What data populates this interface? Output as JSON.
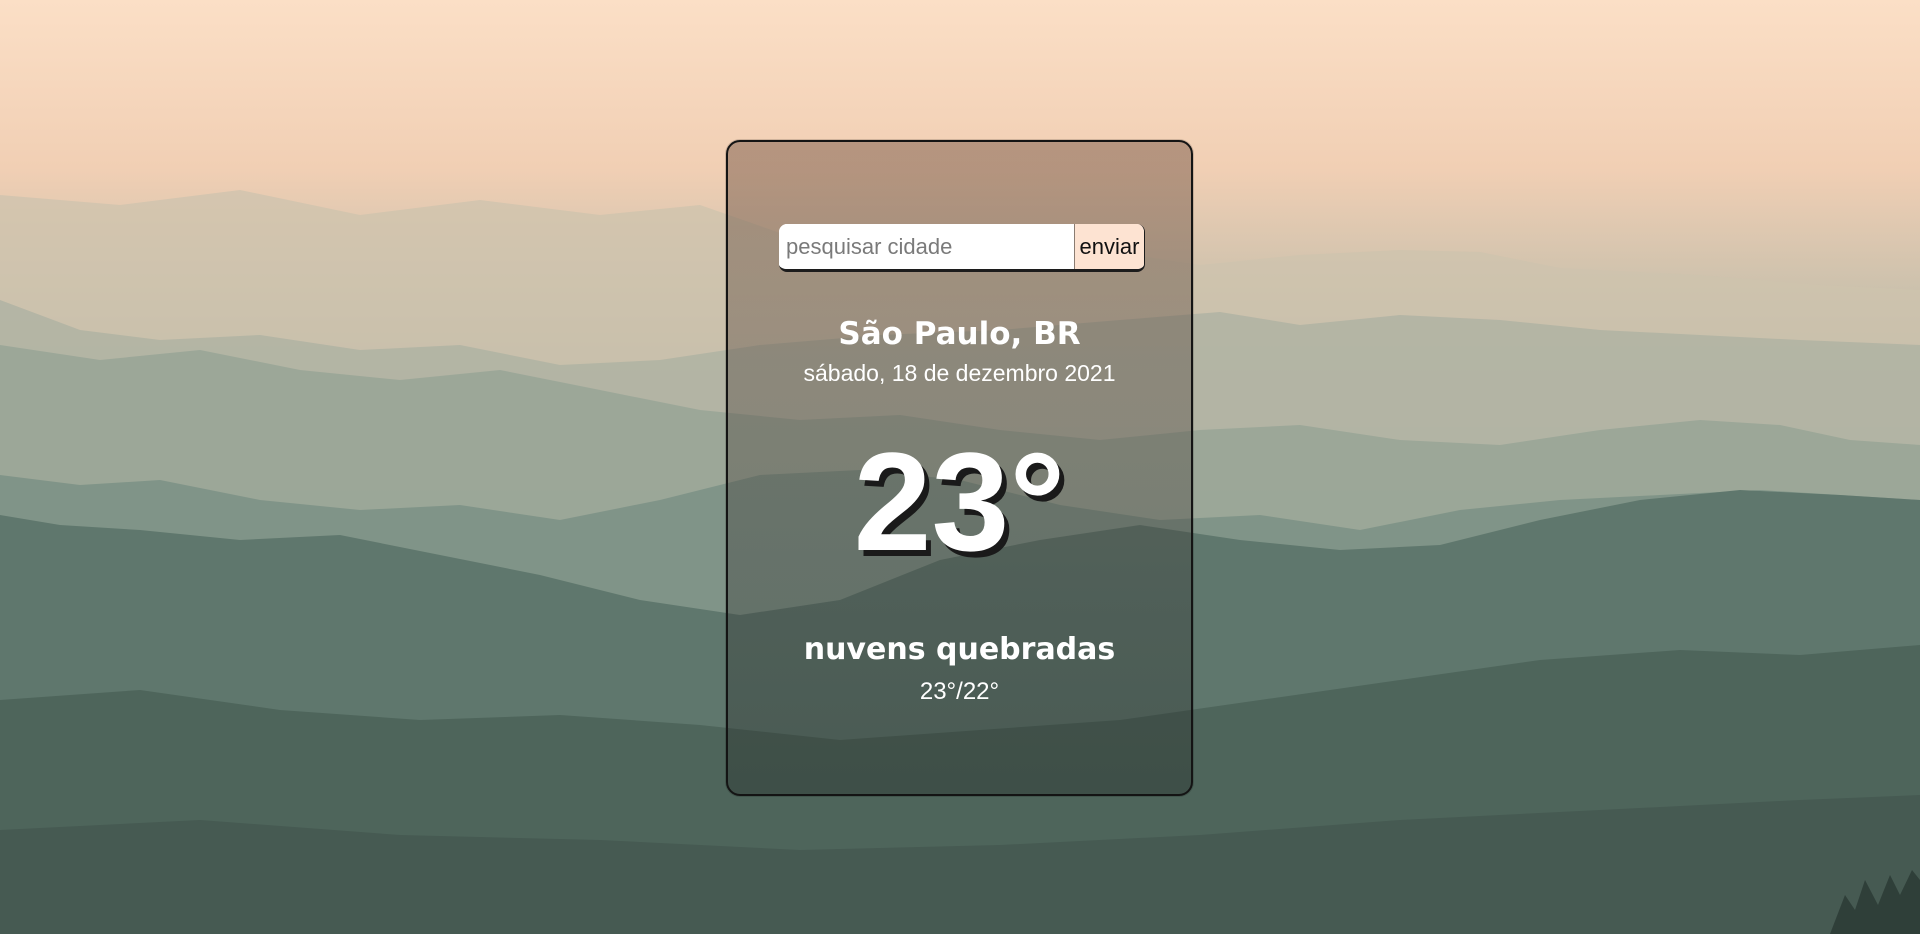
{
  "search": {
    "placeholder": "pesquisar cidade",
    "value": "",
    "button_label": "enviar"
  },
  "weather": {
    "city": "São Paulo, BR",
    "date": "sábado, 18 de dezembro 2021",
    "temperature": "23°",
    "condition": "nuvens quebradas",
    "range": "23°/22°"
  },
  "colors": {
    "sky": "#fbdfc6",
    "mountains": "#4f655b",
    "button_bg": "#fde3d2",
    "text": "#ffffff"
  }
}
